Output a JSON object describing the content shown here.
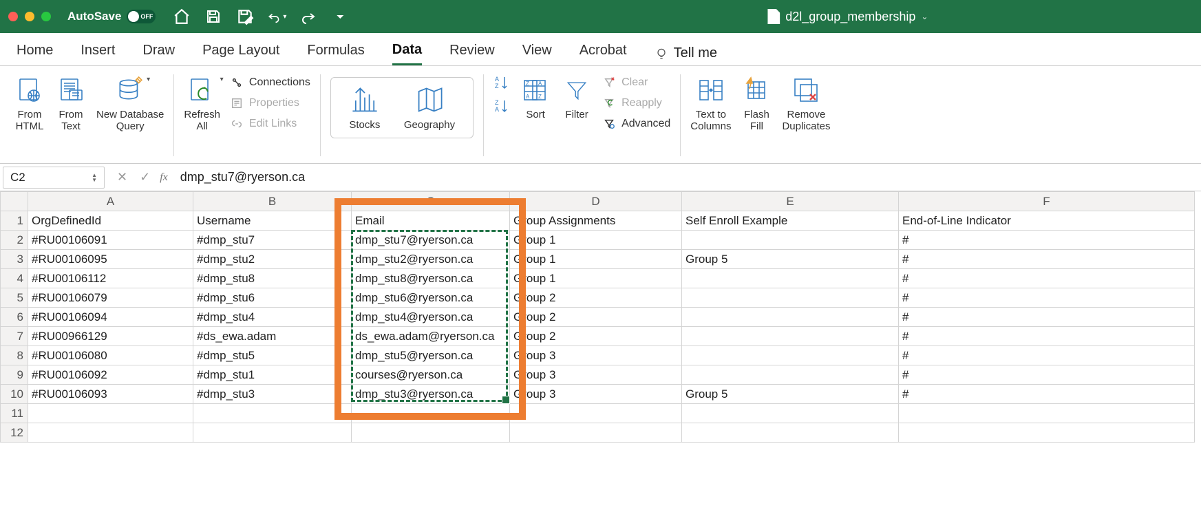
{
  "titleBar": {
    "autosave": "AutoSave",
    "autosaveState": "OFF",
    "filename": "d2l_group_membership"
  },
  "tabs": [
    "Home",
    "Insert",
    "Draw",
    "Page Layout",
    "Formulas",
    "Data",
    "Review",
    "View",
    "Acrobat"
  ],
  "activeTab": "Data",
  "tellMe": "Tell me",
  "ribbon": {
    "fromHtml": "From\nHTML",
    "fromText": "From\nText",
    "newDb": "New Database\nQuery",
    "refresh": "Refresh\nAll",
    "connections": "Connections",
    "properties": "Properties",
    "editLinks": "Edit Links",
    "stocks": "Stocks",
    "geography": "Geography",
    "sort": "Sort",
    "filter": "Filter",
    "clear": "Clear",
    "reapply": "Reapply",
    "advanced": "Advanced",
    "textToCols": "Text to\nColumns",
    "flashFill": "Flash\nFill",
    "removeDup": "Remove\nDuplicates"
  },
  "formulaBar": {
    "cellRef": "C2",
    "fx": "fx",
    "value": "dmp_stu7@ryerson.ca"
  },
  "columns": [
    "A",
    "B",
    "C",
    "D",
    "E",
    "F"
  ],
  "headers": {
    "A": "OrgDefinedId",
    "B": "Username",
    "C": "Email",
    "D": "Group Assignments",
    "E": "Self Enroll Example",
    "F": "End-of-Line Indicator"
  },
  "rows": [
    {
      "n": 2,
      "A": "#RU00106091",
      "B": "#dmp_stu7",
      "C": "dmp_stu7@ryerson.ca",
      "D": "Group 1",
      "E": "",
      "F": "#"
    },
    {
      "n": 3,
      "A": "#RU00106095",
      "B": "#dmp_stu2",
      "C": "dmp_stu2@ryerson.ca",
      "D": "Group 1",
      "E": "Group 5",
      "F": "#"
    },
    {
      "n": 4,
      "A": "#RU00106112",
      "B": "#dmp_stu8",
      "C": "dmp_stu8@ryerson.ca",
      "D": "Group 1",
      "E": "",
      "F": "#"
    },
    {
      "n": 5,
      "A": "#RU00106079",
      "B": "#dmp_stu6",
      "C": "dmp_stu6@ryerson.ca",
      "D": "Group 2",
      "E": "",
      "F": "#"
    },
    {
      "n": 6,
      "A": "#RU00106094",
      "B": "#dmp_stu4",
      "C": "dmp_stu4@ryerson.ca",
      "D": "Group 2",
      "E": "",
      "F": "#"
    },
    {
      "n": 7,
      "A": "#RU00966129",
      "B": "#ds_ewa.adam",
      "C": "ds_ewa.adam@ryerson.ca",
      "D": "Group 2",
      "E": "",
      "F": "#"
    },
    {
      "n": 8,
      "A": "#RU00106080",
      "B": "#dmp_stu5",
      "C": "dmp_stu5@ryerson.ca",
      "D": "Group 3",
      "E": "",
      "F": "#"
    },
    {
      "n": 9,
      "A": "#RU00106092",
      "B": "#dmp_stu1",
      "C": "courses@ryerson.ca",
      "D": "Group 3",
      "E": "",
      "F": "#"
    },
    {
      "n": 10,
      "A": "#RU00106093",
      "B": "#dmp_stu3",
      "C": "dmp_stu3@ryerson.ca",
      "D": "Group 3",
      "E": "Group 5",
      "F": "#"
    }
  ],
  "emptyRows": [
    11,
    12
  ]
}
